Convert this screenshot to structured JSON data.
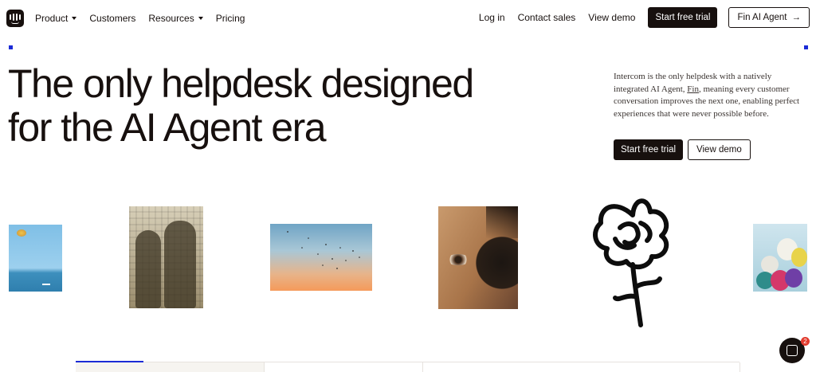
{
  "header": {
    "logo_icon": "intercom-logo-icon",
    "nav": [
      {
        "label": "Product",
        "has_dropdown": true
      },
      {
        "label": "Customers",
        "has_dropdown": false
      },
      {
        "label": "Resources",
        "has_dropdown": true
      },
      {
        "label": "Pricing",
        "has_dropdown": false
      }
    ],
    "login_label": "Log in",
    "contact_label": "Contact sales",
    "demo_label": "View demo",
    "trial_label": "Start free trial",
    "fin_label": "Fin AI Agent",
    "fin_icon": "arrow-right-icon"
  },
  "hero": {
    "headline_line1": "The only helpdesk designed",
    "headline_line2": "for the AI Agent era",
    "intro_before": "Intercom is the only helpdesk with a natively integrated AI Agent, ",
    "intro_link": "Fin",
    "intro_after": ", meaning every customer conversation improves the next one, enabling perfect experiences that were never possible before.",
    "cta_primary": "Start free trial",
    "cta_secondary": "View demo"
  },
  "gallery": [
    {
      "name": "sea-sunset-image"
    },
    {
      "name": "shadow-couple-image"
    },
    {
      "name": "birds-sky-image"
    },
    {
      "name": "closeup-eye-image"
    },
    {
      "name": "ink-flower-illustration"
    },
    {
      "name": "balloons-image"
    }
  ],
  "chat": {
    "icon": "chat-bubble-icon",
    "badge_count": "2"
  },
  "colors": {
    "text": "#17100e",
    "accent": "#1b2bd6",
    "badge": "#e23b2e"
  }
}
